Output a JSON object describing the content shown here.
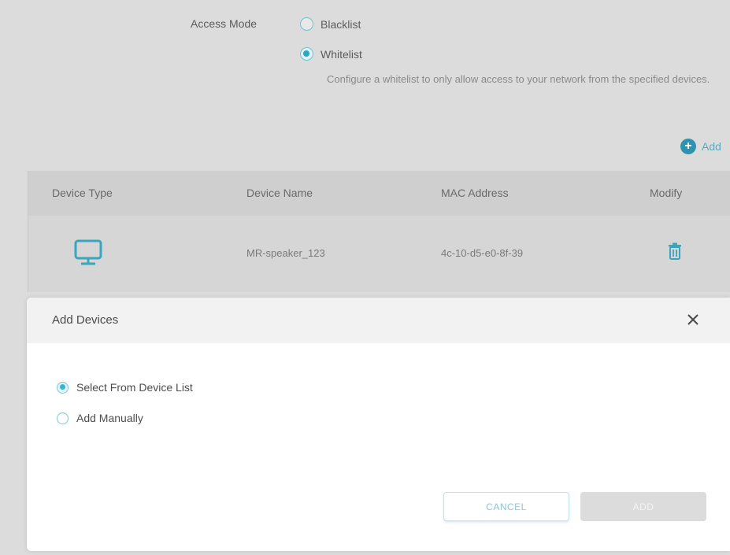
{
  "access": {
    "label": "Access Mode",
    "options": [
      {
        "label": "Blacklist",
        "selected": false
      },
      {
        "label": "Whitelist",
        "selected": true
      }
    ],
    "description": "Configure a whitelist to only allow access to your network from the specified devices."
  },
  "add_link": {
    "label": "Add",
    "icon": "plus-circle-icon"
  },
  "table": {
    "columns": [
      "Device Type",
      "Device Name",
      "MAC Address",
      "Modify"
    ],
    "rows": [
      {
        "device_type_icon": "monitor-icon",
        "device_name": "MR-speaker_123",
        "mac": "4c-10-d5-e0-8f-39",
        "modify_icon": "trash-icon"
      }
    ]
  },
  "modal": {
    "title": "Add Devices",
    "close_icon": "close-icon",
    "options": [
      {
        "label": "Select From Device List",
        "selected": true
      },
      {
        "label": "Add Manually",
        "selected": false
      }
    ],
    "cancel_label": "CANCEL",
    "add_label": "ADD"
  },
  "colors": {
    "accent": "#2ea7c3",
    "overlay_background": "#dcdcdc",
    "add_button_disabled": "#dcdcdc"
  }
}
